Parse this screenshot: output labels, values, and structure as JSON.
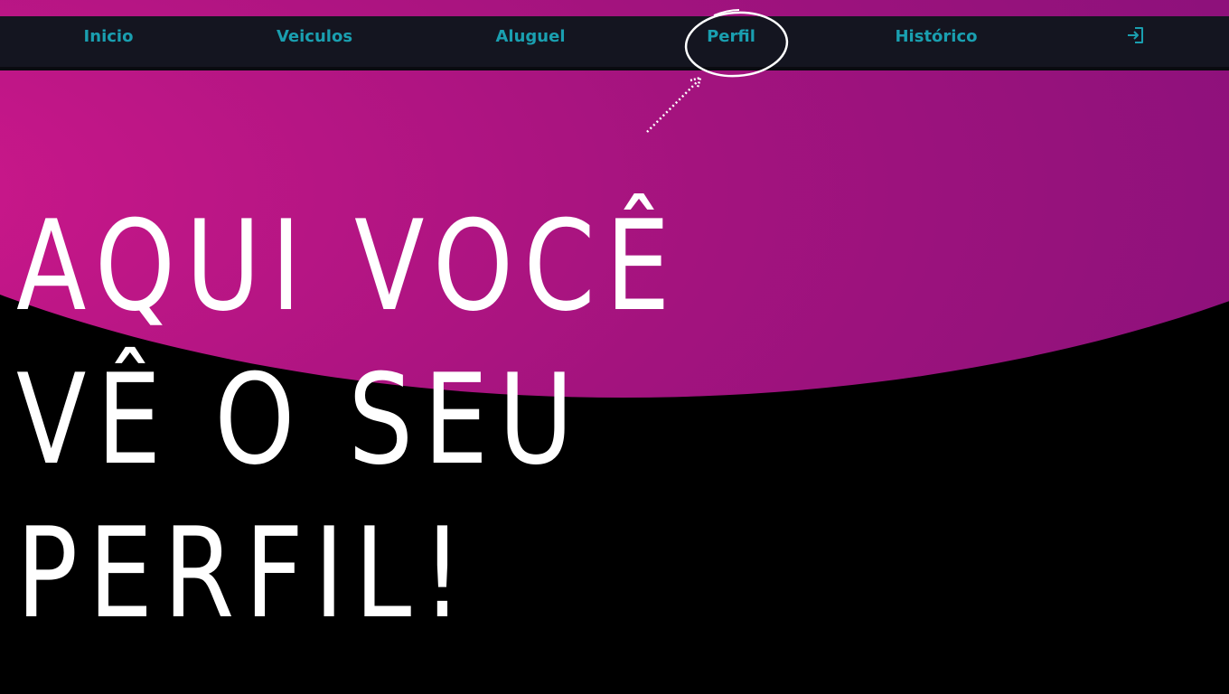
{
  "nav": {
    "items": [
      {
        "label": "Inicio"
      },
      {
        "label": "Veiculos"
      },
      {
        "label": "Aluguel"
      },
      {
        "label": "Perfil"
      },
      {
        "label": "Histórico"
      }
    ],
    "logout_icon": "sign-in-arrow-icon"
  },
  "hero": {
    "lines": [
      "AQUI VOCÊ",
      "VÊ O SEU",
      "PERFIL!"
    ]
  },
  "annotation": {
    "highlighted_item": "Perfil"
  },
  "colors": {
    "nav_text": "#1a9fb0",
    "nav_background": "#141520",
    "hero_gradient_start": "#d0188c",
    "hero_gradient_end": "#6e0f7a",
    "background": "#000000",
    "headline": "#ffffff"
  }
}
